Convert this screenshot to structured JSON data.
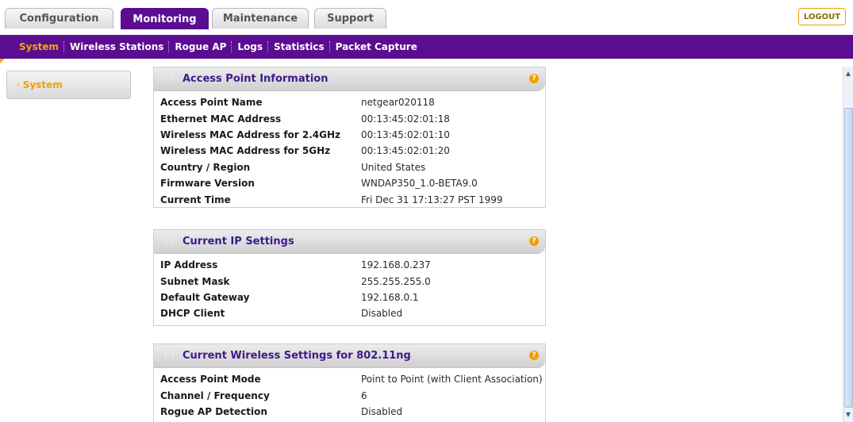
{
  "tabs": [
    {
      "label": "Configuration"
    },
    {
      "label": "Monitoring"
    },
    {
      "label": "Maintenance"
    },
    {
      "label": "Support"
    }
  ],
  "logout_label": "LOGOUT",
  "subnav": [
    {
      "label": "System"
    },
    {
      "label": "Wireless Stations"
    },
    {
      "label": "Rogue AP"
    },
    {
      "label": "Logs"
    },
    {
      "label": "Statistics"
    },
    {
      "label": "Packet Capture"
    }
  ],
  "sidebar": {
    "items": [
      {
        "label": "System"
      }
    ]
  },
  "panels": {
    "access_point": {
      "title": "Access Point Information",
      "rows": [
        {
          "label": "Access Point Name",
          "value": "netgear020118"
        },
        {
          "label": "Ethernet MAC Address",
          "value": "00:13:45:02:01:18"
        },
        {
          "label": "Wireless MAC Address for 2.4GHz",
          "value": "00:13:45:02:01:10"
        },
        {
          "label": "Wireless MAC Address for 5GHz",
          "value": "00:13:45:02:01:20"
        },
        {
          "label": "Country / Region",
          "value": "United States"
        },
        {
          "label": "Firmware Version",
          "value": "WNDAP350_1.0-BETA9.0"
        },
        {
          "label": "Current Time",
          "value": "Fri Dec 31 17:13:27 PST 1999"
        }
      ]
    },
    "ip_settings": {
      "title": "Current IP Settings",
      "rows": [
        {
          "label": "IP Address",
          "value": "192.168.0.237"
        },
        {
          "label": "Subnet Mask",
          "value": "255.255.255.0"
        },
        {
          "label": "Default Gateway",
          "value": "192.168.0.1"
        },
        {
          "label": "DHCP Client",
          "value": "Disabled"
        }
      ]
    },
    "wireless_settings": {
      "title": "Current Wireless Settings for 802.11ng",
      "rows": [
        {
          "label": "Access Point Mode",
          "value": "Point to Point (with Client Association)"
        },
        {
          "label": "Channel / Frequency",
          "value": "6"
        },
        {
          "label": "Rogue AP Detection",
          "value": "Disabled"
        }
      ]
    }
  },
  "icons": {
    "help": "help-icon",
    "grip": "drag-grip-icon",
    "menu_arrow": "chevron-right-icon"
  },
  "colors": {
    "brand_purple": "#5a0d91",
    "accent_orange": "#f5a800",
    "panel_title": "#3d1a8c"
  }
}
